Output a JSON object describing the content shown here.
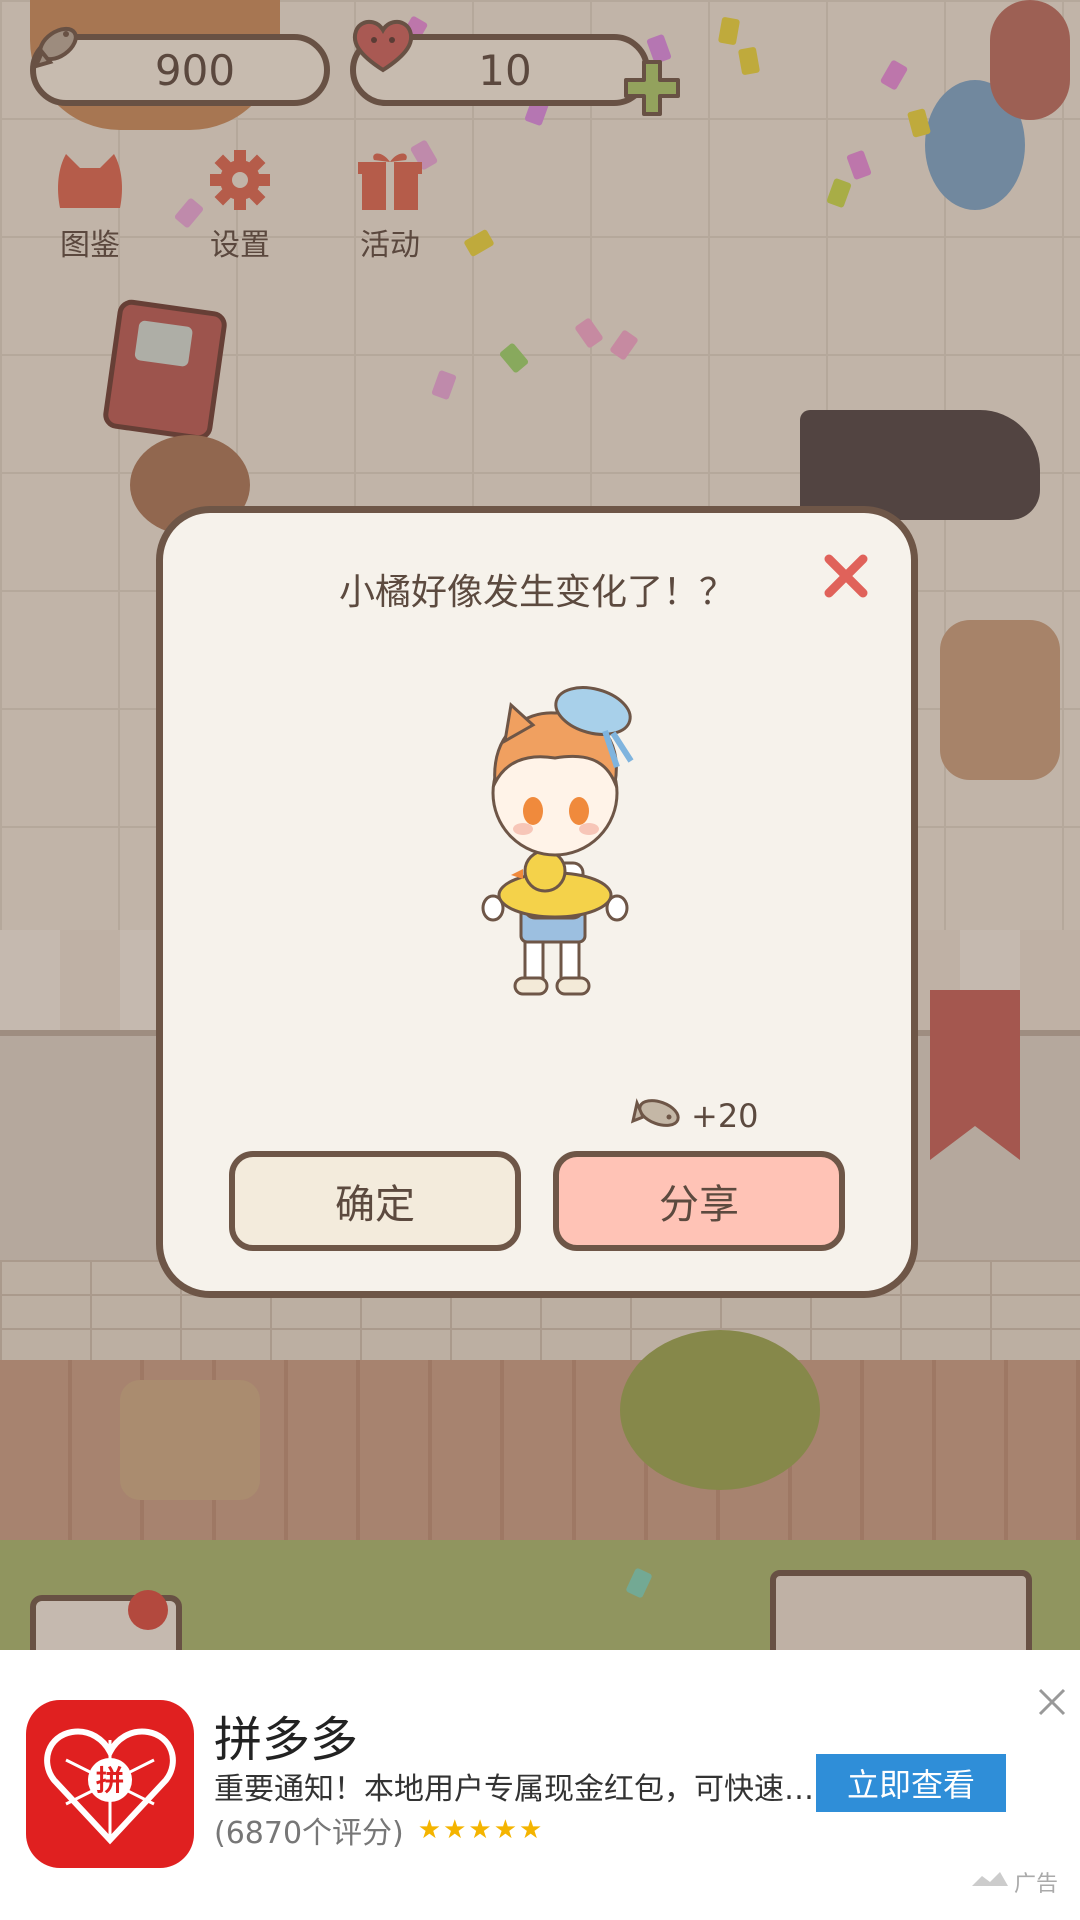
{
  "hud": {
    "fish_count": "900",
    "heart_count": "10",
    "menu": [
      {
        "label": "图鉴",
        "icon": "cat-head-icon"
      },
      {
        "label": "设置",
        "icon": "gear-icon"
      },
      {
        "label": "活动",
        "icon": "gift-icon"
      }
    ]
  },
  "dialog": {
    "title": "小橘好像发生变化了！？",
    "reward_amount": "+20",
    "confirm_label": "确定",
    "share_label": "分享"
  },
  "ad": {
    "app_name": "拼多多",
    "description": "重要通知！本地用户专属现金红包，可快速…",
    "reviews": "(6870个评分)",
    "stars": "★★★★★",
    "cta_label": "立即查看",
    "ad_label": "广告"
  },
  "colors": {
    "outline": "#6e5647",
    "confirm_button": "#f3ebdc",
    "share_button": "#ffc3b6",
    "cta_blue": "#2f8ed8",
    "logo_red": "#e02020"
  }
}
